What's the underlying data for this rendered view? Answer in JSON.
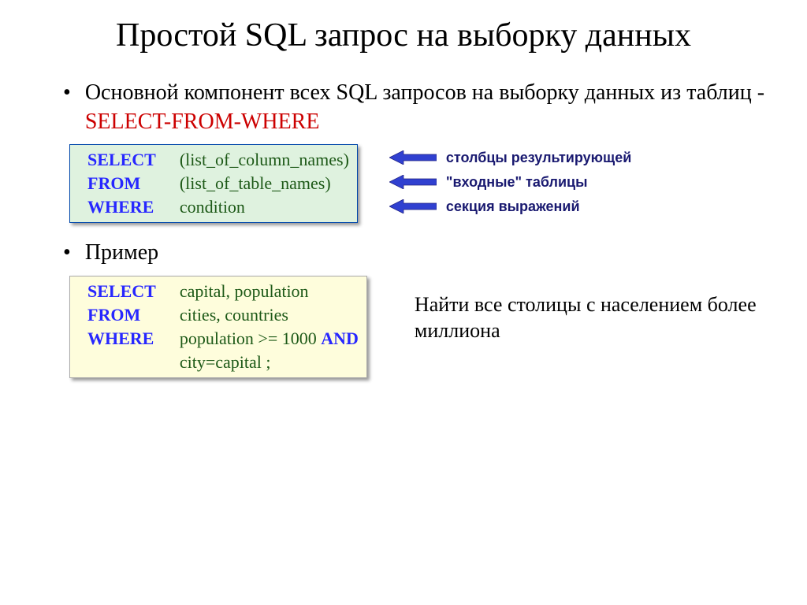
{
  "title": "Простой SQL запрос на выборку данных",
  "bullet1_part1": "Основной компонент всех SQL запросов на выборку данных из таблиц - ",
  "bullet1_redpart": "SELECT-FROM-WHERE",
  "syntax": {
    "select_kw": "SELECT",
    "select_val": "(list_of_column_names)",
    "from_kw": "FROM",
    "from_val": "(list_of_table_names)",
    "where_kw": "WHERE",
    "where_val": "condition"
  },
  "annotations": {
    "line1": "столбцы результирующей",
    "line2": "\"входные\" таблицы",
    "line3": "секция выражений"
  },
  "bullet2": "Пример",
  "example": {
    "select_kw": "SELECT",
    "select_val": "capital, population",
    "from_kw": "FROM",
    "from_val": "cities, countries",
    "where_kw": "WHERE",
    "where_val_pre": "population  >= 1000 ",
    "where_and": "AND",
    "where_val_post": "city=capital ;"
  },
  "example_desc": "Найти все столицы с населением более миллиона"
}
